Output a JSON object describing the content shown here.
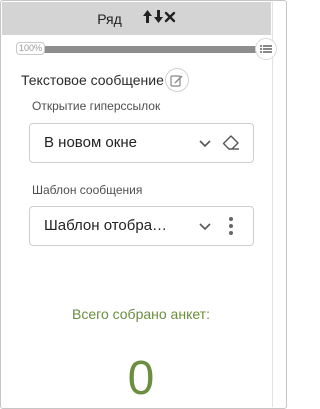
{
  "header": {
    "title": "Ряд",
    "icons": [
      "move-up-icon",
      "move-down-icon",
      "close-icon"
    ]
  },
  "progress": {
    "label": "100%",
    "percent": 100
  },
  "question": {
    "title": "Текстовое сообщение",
    "edit_icon": "pencil-edit-icon"
  },
  "link_opening": {
    "label": "Открытие гиперссылок",
    "value": "В новом окне",
    "icons": [
      "chevron-down-icon",
      "eraser-icon"
    ]
  },
  "message_template": {
    "label": "Шаблон сообщения",
    "value": "Шаблон отобра…",
    "icons": [
      "chevron-down-icon",
      "more-vertical-icon"
    ]
  },
  "stats": {
    "label": "Всего собрано анкет:",
    "count": "0"
  },
  "colors": {
    "header_bg": "#d4d4d4",
    "accent_green": "#6b8e3f",
    "border": "#cfcfcf"
  }
}
